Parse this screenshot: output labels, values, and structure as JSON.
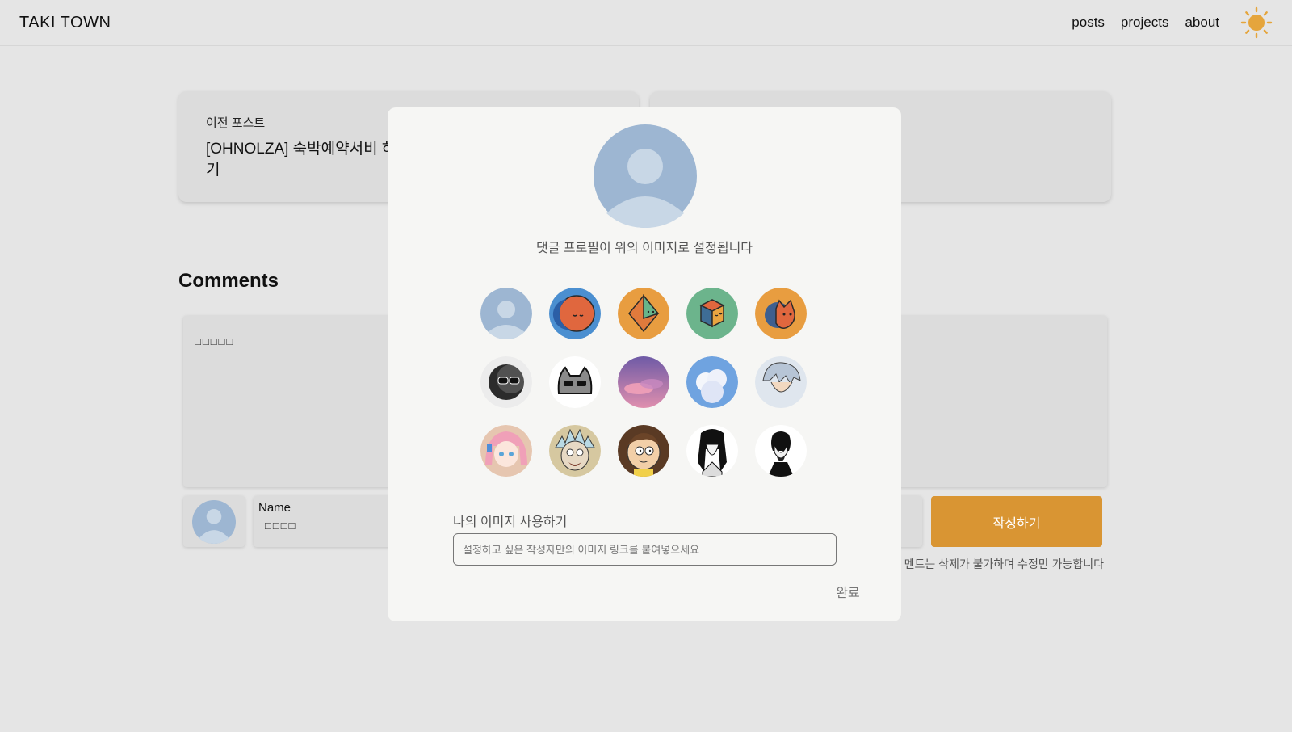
{
  "header": {
    "brand": "TAKI TOWN",
    "nav": [
      "posts",
      "projects",
      "about"
    ],
    "theme_icon": "sun-icon"
  },
  "post_nav": {
    "prev_label": "이전 포스트",
    "prev_title": "[OHNOLZA] 숙박예약서비 하기"
  },
  "comments": {
    "title": "Comments",
    "textarea_value": "□□□□□",
    "name_label": "Name",
    "name_value": "□□□□",
    "submit_label": "작성하기",
    "notice": "멘트는 삭제가 불가하며 수정만 가능합니다"
  },
  "modal": {
    "caption": "댓글 프로필이 위의 이미지로 설정됩니다",
    "avatars": [
      "default-person-avatar",
      "orange-moon-avatar",
      "orange-crystal-avatar",
      "green-cube-avatar",
      "orange-cat-avatar",
      "sunglasses-moon-avatar",
      "sunglasses-cat-avatar",
      "purple-clouds-avatar",
      "blue-clouds-avatar",
      "anime-silver-hair-avatar",
      "anime-pink-hair-avatar",
      "rick-avatar",
      "morty-avatar",
      "manga-long-hair-avatar",
      "manga-bearded-man-avatar"
    ],
    "custom_label": "나의 이미지 사용하기",
    "custom_placeholder": "설정하고 싶은 작성자만의 이미지 링크를 붙여넣으세요",
    "done_label": "완료"
  },
  "colors": {
    "accent": "#d99533",
    "avatar_blue": "#9db6d2",
    "background": "#e5e5e5",
    "modal_bg": "#f6f6f4"
  }
}
